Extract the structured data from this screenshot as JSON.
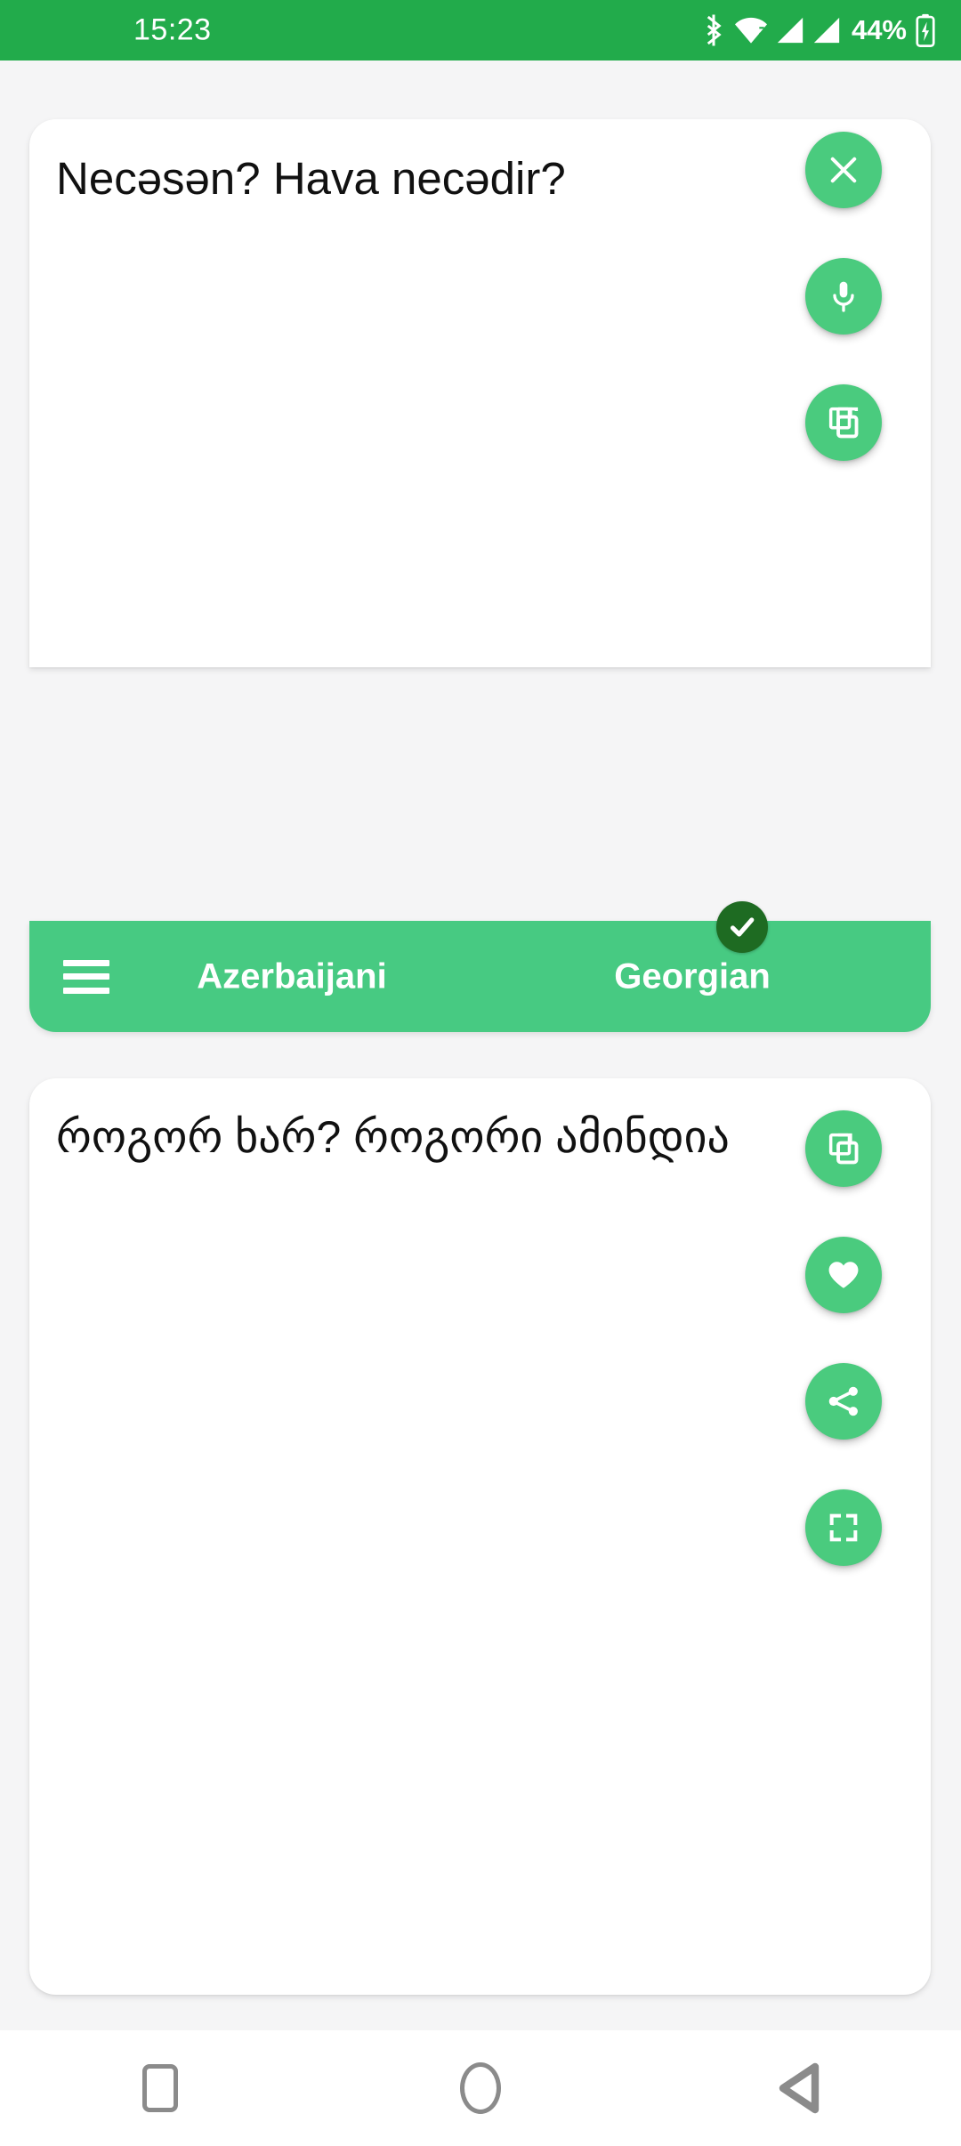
{
  "status_bar": {
    "clock": "15:23",
    "battery_percent": "44%",
    "icons": [
      "bluetooth-icon",
      "wifi-icon",
      "signal-bars-icon",
      "signal-bars-2-icon",
      "battery-charging-icon"
    ],
    "background_color": "#22ab4b"
  },
  "source_panel": {
    "text": "Necəsən? Hava necədir?",
    "actions": [
      {
        "name": "clear-button",
        "icon": "close-icon",
        "label": "Clear"
      },
      {
        "name": "voice-input-button",
        "icon": "microphone-icon",
        "label": "Speak"
      },
      {
        "name": "copy-source-button",
        "icon": "copy-icon",
        "label": "Copy"
      }
    ]
  },
  "language_bar": {
    "menu_icon": "hamburger-menu-icon",
    "source_language": "Azerbaijani",
    "target_language": "Georgian",
    "target_verified_icon": "check-badge-icon",
    "background_color": "#47ca82",
    "check_badge_color": "#1e6b22"
  },
  "target_panel": {
    "text": "როგორ ხარ? როგორი ამინდია",
    "actions": [
      {
        "name": "copy-translation-button",
        "icon": "copy-icon",
        "label": "Copy"
      },
      {
        "name": "favorite-button",
        "icon": "heart-icon",
        "label": "Favorite"
      },
      {
        "name": "share-button",
        "icon": "share-icon",
        "label": "Share"
      },
      {
        "name": "fullscreen-button",
        "icon": "fullscreen-icon",
        "label": "Fullscreen"
      }
    ]
  },
  "nav_bar": {
    "buttons": [
      {
        "name": "nav-recents-button",
        "icon": "square-icon"
      },
      {
        "name": "nav-home-button",
        "icon": "circle-icon"
      },
      {
        "name": "nav-back-button",
        "icon": "triangle-left-icon"
      }
    ]
  },
  "theme": {
    "accent": "#4acb7e",
    "status_bar_green": "#22ab4b",
    "page_background": "#f5f5f6",
    "card_background": "#ffffff",
    "text_color": "#111111"
  }
}
